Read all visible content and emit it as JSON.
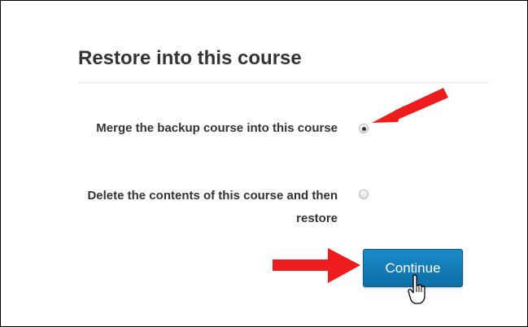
{
  "section": {
    "title": "Restore into this course"
  },
  "options": [
    {
      "label": "Merge the backup course into this course",
      "selected": true
    },
    {
      "label": "Delete the contents of this course and then restore",
      "selected": false
    }
  ],
  "continue_button": {
    "label": "Continue"
  },
  "annotations": {
    "arrow_color": "#ee1c1c",
    "icons": [
      "arrow-pointer-icon",
      "hand-cursor-icon"
    ]
  },
  "colors": {
    "button": "#1a89c9",
    "text": "#333333"
  }
}
